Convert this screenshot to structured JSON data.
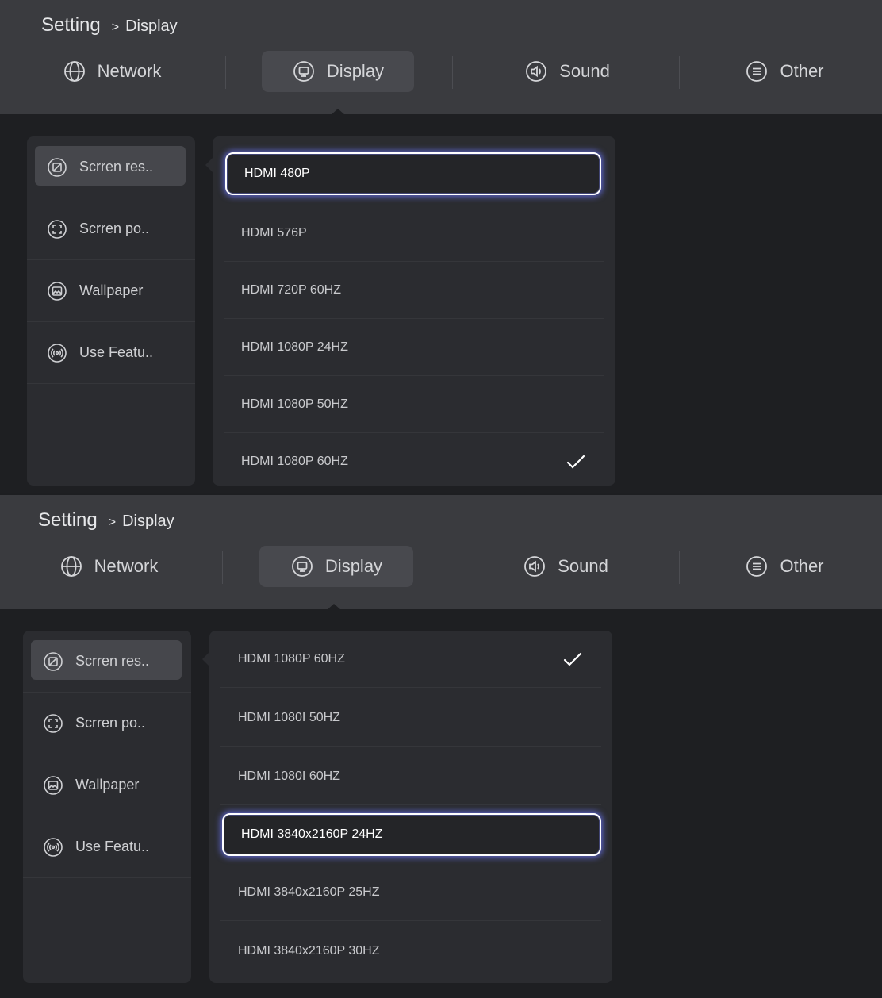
{
  "screens": [
    {
      "breadcrumb": {
        "root": "Setting",
        "separator": ">",
        "page": "Display"
      },
      "tabs": [
        {
          "label": "Network",
          "icon": "globe-icon",
          "active": false
        },
        {
          "label": "Display",
          "icon": "monitor-icon",
          "active": true
        },
        {
          "label": "Sound",
          "icon": "speaker-icon",
          "active": false
        },
        {
          "label": "Other",
          "icon": "menu-icon",
          "active": false
        }
      ],
      "sidebar": [
        {
          "label": "Scrren res..",
          "icon": "resolution-icon",
          "active": true
        },
        {
          "label": "Scrren po..",
          "icon": "expand-icon",
          "active": false
        },
        {
          "label": "Wallpaper",
          "icon": "image-icon",
          "active": false
        },
        {
          "label": "Use Featu..",
          "icon": "broadcast-icon",
          "active": false
        }
      ],
      "options": [
        {
          "label": "HDMI 480P",
          "focused": true,
          "selected": false
        },
        {
          "label": "HDMI 576P",
          "focused": false,
          "selected": false
        },
        {
          "label": "HDMI 720P 60HZ",
          "focused": false,
          "selected": false
        },
        {
          "label": "HDMI 1080P 24HZ",
          "focused": false,
          "selected": false
        },
        {
          "label": "HDMI 1080P 50HZ",
          "focused": false,
          "selected": false
        },
        {
          "label": "HDMI 1080P 60HZ",
          "focused": false,
          "selected": true
        }
      ]
    },
    {
      "breadcrumb": {
        "root": "Setting",
        "separator": ">",
        "page": "Display"
      },
      "tabs": [
        {
          "label": "Network",
          "icon": "globe-icon",
          "active": false
        },
        {
          "label": "Display",
          "icon": "monitor-icon",
          "active": true
        },
        {
          "label": "Sound",
          "icon": "speaker-icon",
          "active": false
        },
        {
          "label": "Other",
          "icon": "menu-icon",
          "active": false
        }
      ],
      "sidebar": [
        {
          "label": "Scrren res..",
          "icon": "resolution-icon",
          "active": true
        },
        {
          "label": "Scrren po..",
          "icon": "expand-icon",
          "active": false
        },
        {
          "label": "Wallpaper",
          "icon": "image-icon",
          "active": false
        },
        {
          "label": "Use Featu..",
          "icon": "broadcast-icon",
          "active": false
        }
      ],
      "options": [
        {
          "label": "HDMI 1080P 60HZ",
          "focused": false,
          "selected": true
        },
        {
          "label": "HDMI 1080I 50HZ",
          "focused": false,
          "selected": false
        },
        {
          "label": "HDMI 1080I 60HZ",
          "focused": false,
          "selected": false
        },
        {
          "label": "HDMI 3840x2160P 24HZ",
          "focused": true,
          "selected": false
        },
        {
          "label": "HDMI 3840x2160P 25HZ",
          "focused": false,
          "selected": false
        },
        {
          "label": "HDMI 3840x2160P 30HZ",
          "focused": false,
          "selected": false
        }
      ]
    }
  ]
}
